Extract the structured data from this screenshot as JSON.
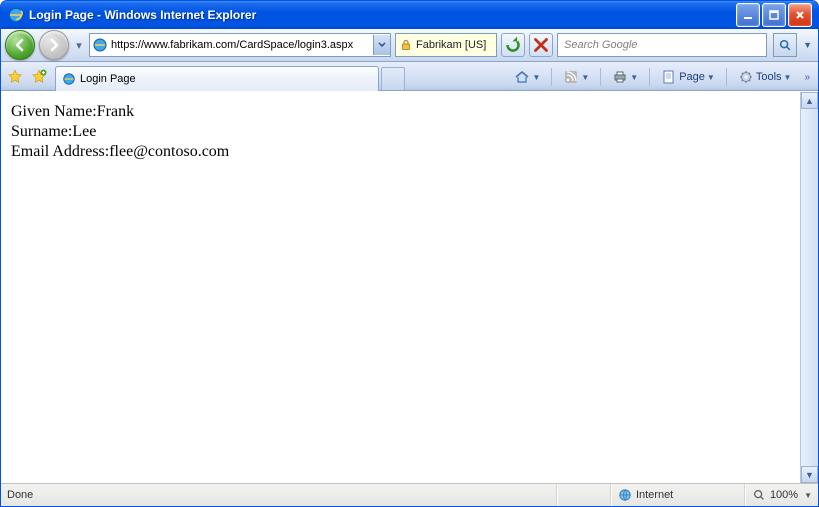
{
  "window": {
    "title": "Login Page - Windows Internet Explorer"
  },
  "nav": {
    "url": "https://www.fabrikam.com/CardSpace/login3.aspx",
    "cert_label": "Fabrikam [US]",
    "search_placeholder": "Search Google"
  },
  "tabs": {
    "active": "Login Page"
  },
  "toolbar": {
    "page_label": "Page",
    "tools_label": "Tools"
  },
  "content": {
    "lines": [
      {
        "label": "Given Name:",
        "value": "Frank"
      },
      {
        "label": "Surname:",
        "value": "Lee"
      },
      {
        "label": "Email Address:",
        "value": "flee@contoso.com"
      }
    ]
  },
  "status": {
    "left": "Done",
    "zone": "Internet",
    "zoom": "100%"
  }
}
